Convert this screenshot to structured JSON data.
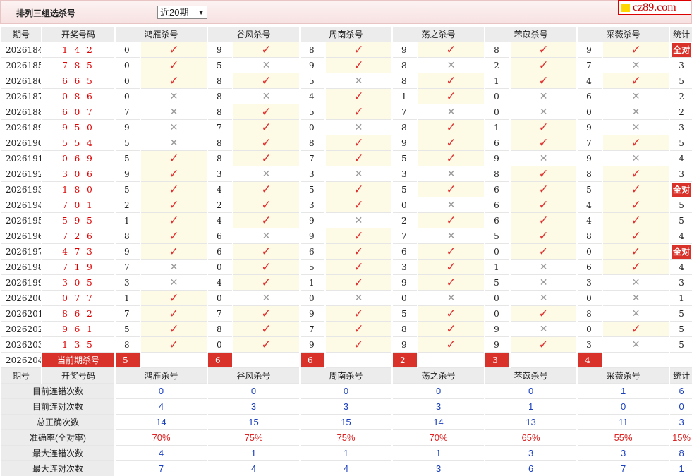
{
  "header": {
    "title": "排列三组选杀号",
    "period_select": "近20期",
    "logo": "cz89.com"
  },
  "columns": {
    "period": "期号",
    "numbers": "开奖号码",
    "stat": "统计",
    "experts": [
      "鸿雁杀号",
      "谷风杀号",
      "周南杀号",
      "荡之杀号",
      "芣苡杀号",
      "采薇杀号"
    ]
  },
  "rows": [
    {
      "p": "2026184",
      "n": "1 4 2",
      "k": [
        "0",
        "9",
        "8",
        "9",
        "8",
        "9"
      ],
      "r": [
        1,
        1,
        1,
        1,
        1,
        1
      ],
      "s": "全对"
    },
    {
      "p": "2026185",
      "n": "7 8 5",
      "k": [
        "0",
        "5",
        "9",
        "8",
        "2",
        "7"
      ],
      "r": [
        1,
        0,
        1,
        0,
        1,
        0
      ],
      "s": "3"
    },
    {
      "p": "2026186",
      "n": "6 6 5",
      "k": [
        "0",
        "8",
        "5",
        "8",
        "1",
        "4"
      ],
      "r": [
        1,
        1,
        0,
        1,
        1,
        1
      ],
      "s": "5"
    },
    {
      "p": "2026187",
      "n": "0 8 6",
      "k": [
        "0",
        "8",
        "4",
        "1",
        "0",
        "6"
      ],
      "r": [
        0,
        0,
        1,
        1,
        0,
        0
      ],
      "s": "2"
    },
    {
      "p": "2026188",
      "n": "6 0 7",
      "k": [
        "7",
        "8",
        "5",
        "7",
        "0",
        "0"
      ],
      "r": [
        0,
        1,
        1,
        0,
        0,
        0
      ],
      "s": "2"
    },
    {
      "p": "2026189",
      "n": "9 5 0",
      "k": [
        "9",
        "7",
        "0",
        "8",
        "1",
        "9"
      ],
      "r": [
        0,
        1,
        0,
        1,
        1,
        0
      ],
      "s": "3"
    },
    {
      "p": "2026190",
      "n": "5 5 4",
      "k": [
        "5",
        "8",
        "8",
        "9",
        "6",
        "7"
      ],
      "r": [
        0,
        1,
        1,
        1,
        1,
        1
      ],
      "s": "5"
    },
    {
      "p": "2026191",
      "n": "0 6 9",
      "k": [
        "5",
        "8",
        "7",
        "5",
        "9",
        "9"
      ],
      "r": [
        1,
        1,
        1,
        1,
        0,
        0
      ],
      "s": "4"
    },
    {
      "p": "2026192",
      "n": "3 0 6",
      "k": [
        "9",
        "3",
        "3",
        "3",
        "8",
        "8"
      ],
      "r": [
        1,
        0,
        0,
        0,
        1,
        1
      ],
      "s": "3"
    },
    {
      "p": "2026193",
      "n": "1 8 0",
      "k": [
        "5",
        "4",
        "5",
        "5",
        "6",
        "5"
      ],
      "r": [
        1,
        1,
        1,
        1,
        1,
        1
      ],
      "s": "全对"
    },
    {
      "p": "2026194",
      "n": "7 0 1",
      "k": [
        "2",
        "2",
        "3",
        "0",
        "6",
        "4"
      ],
      "r": [
        1,
        1,
        1,
        0,
        1,
        1
      ],
      "s": "5"
    },
    {
      "p": "2026195",
      "n": "5 9 5",
      "k": [
        "1",
        "4",
        "9",
        "2",
        "6",
        "4"
      ],
      "r": [
        1,
        1,
        0,
        1,
        1,
        1
      ],
      "s": "5"
    },
    {
      "p": "2026196",
      "n": "7 2 6",
      "k": [
        "8",
        "6",
        "9",
        "7",
        "5",
        "8"
      ],
      "r": [
        1,
        0,
        1,
        0,
        1,
        1
      ],
      "s": "4"
    },
    {
      "p": "2026197",
      "n": "4 7 3",
      "k": [
        "9",
        "6",
        "6",
        "6",
        "0",
        "0"
      ],
      "r": [
        1,
        1,
        1,
        1,
        1,
        1
      ],
      "s": "全对"
    },
    {
      "p": "2026198",
      "n": "7 1 9",
      "k": [
        "7",
        "0",
        "5",
        "3",
        "1",
        "6"
      ],
      "r": [
        0,
        1,
        1,
        1,
        0,
        1
      ],
      "s": "4"
    },
    {
      "p": "2026199",
      "n": "3 0 5",
      "k": [
        "3",
        "4",
        "1",
        "9",
        "5",
        "3"
      ],
      "r": [
        0,
        1,
        1,
        1,
        0,
        0
      ],
      "s": "3"
    },
    {
      "p": "2026200",
      "n": "0 7 7",
      "k": [
        "1",
        "0",
        "0",
        "0",
        "0",
        "0"
      ],
      "r": [
        1,
        0,
        0,
        0,
        0,
        0
      ],
      "s": "1"
    },
    {
      "p": "2026201",
      "n": "8 6 2",
      "k": [
        "7",
        "7",
        "9",
        "5",
        "0",
        "8"
      ],
      "r": [
        1,
        1,
        1,
        1,
        1,
        0
      ],
      "s": "5"
    },
    {
      "p": "2026202",
      "n": "9 6 1",
      "k": [
        "5",
        "8",
        "7",
        "8",
        "9",
        "0"
      ],
      "r": [
        1,
        1,
        1,
        1,
        0,
        1
      ],
      "s": "5"
    },
    {
      "p": "2026203",
      "n": "1 3 5",
      "k": [
        "8",
        "0",
        "9",
        "9",
        "9",
        "3"
      ],
      "r": [
        1,
        1,
        1,
        1,
        1,
        0
      ],
      "s": "5"
    }
  ],
  "current": {
    "period": "2026204",
    "label": "当前期杀号",
    "kills": [
      "5",
      "6",
      "6",
      "2",
      "3",
      "4"
    ]
  },
  "summary": [
    {
      "label": "目前连错次数",
      "v": [
        "0",
        "0",
        "0",
        "0",
        "0",
        "1"
      ],
      "s": "6",
      "red": false
    },
    {
      "label": "目前连对次数",
      "v": [
        "4",
        "3",
        "3",
        "3",
        "1",
        "0"
      ],
      "s": "0",
      "red": false
    },
    {
      "label": "总正确次数",
      "v": [
        "14",
        "15",
        "15",
        "14",
        "13",
        "11"
      ],
      "s": "3",
      "red": false
    },
    {
      "label": "准确率(全对率)",
      "v": [
        "70%",
        "75%",
        "75%",
        "70%",
        "65%",
        "55%"
      ],
      "s": "15%",
      "red": true
    },
    {
      "label": "最大连错次数",
      "v": [
        "4",
        "1",
        "1",
        "1",
        "3",
        "3"
      ],
      "s": "8",
      "red": false
    },
    {
      "label": "最大连对次数",
      "v": [
        "7",
        "4",
        "4",
        "3",
        "6",
        "7"
      ],
      "s": "1",
      "red": false
    }
  ],
  "icons": {
    "correct": "check-icon",
    "wrong": "cross-icon"
  },
  "colors": {
    "accent_red": "#d9322b",
    "summary_blue": "#1a3fbf",
    "tick_red": "#e03030"
  }
}
